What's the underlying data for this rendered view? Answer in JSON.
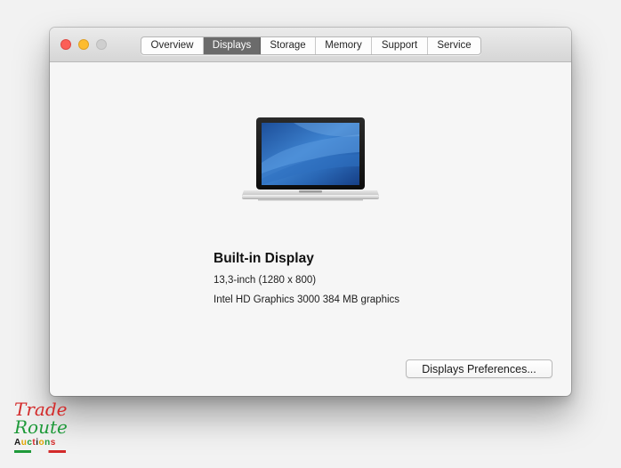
{
  "window": {
    "tabs": [
      {
        "label": "Overview",
        "active": false
      },
      {
        "label": "Displays",
        "active": true
      },
      {
        "label": "Storage",
        "active": false
      },
      {
        "label": "Memory",
        "active": false
      },
      {
        "label": "Support",
        "active": false
      },
      {
        "label": "Service",
        "active": false
      }
    ]
  },
  "display": {
    "title": "Built-in Display",
    "size": "13,3-inch (1280 x 800)",
    "graphics": "Intel HD Graphics 3000 384 MB graphics"
  },
  "buttons": {
    "preferences_label": "Displays Preferences..."
  },
  "watermark": {
    "line1": "Trade",
    "line2": "Route",
    "line3": "Auctions"
  },
  "colors": {
    "close": "#fc5f57",
    "minimize": "#fdbc2e",
    "zoom_inactive": "#cfcfcf",
    "active_tab": "#6b6b6b"
  },
  "icons": {
    "laptop": "macbook-pro-laptop-icon"
  }
}
